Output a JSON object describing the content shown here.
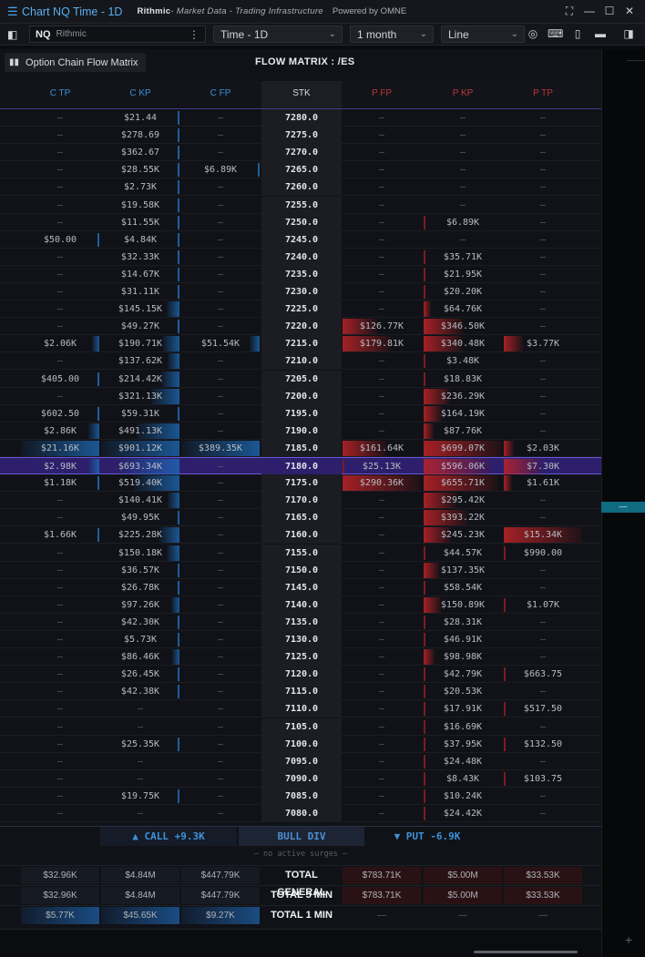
{
  "window": {
    "title": "Chart NQ Time - 1D",
    "brand": "Rithmic",
    "brand_tagline": "- Market Data - Trading Infrastructure",
    "powered_by": "Powered by OMNE"
  },
  "toolbar": {
    "symbol": "NQ",
    "source": "Rithmic",
    "timeframe": "Time - 1D",
    "period": "1 month",
    "chart_type": "Line"
  },
  "panel": {
    "tab_label": "Option Chain Flow Matrix",
    "title": "FLOW MATRIX : /ES"
  },
  "columns": [
    "C TP",
    "C KP",
    "C FP",
    "STK",
    "P FP",
    "P KP",
    "P TP"
  ],
  "rows": [
    {
      "ctp": "—",
      "ckp": "$21.44",
      "cfp": "—",
      "stk": "7280.0",
      "pfp": "—",
      "pkp": "—",
      "ptp": "—"
    },
    {
      "ctp": "—",
      "ckp": "$278.69",
      "cfp": "—",
      "stk": "7275.0",
      "pfp": "—",
      "pkp": "—",
      "ptp": "—"
    },
    {
      "ctp": "—",
      "ckp": "$362.67",
      "cfp": "—",
      "stk": "7270.0",
      "pfp": "—",
      "pkp": "—",
      "ptp": "—"
    },
    {
      "ctp": "—",
      "ckp": "$28.55K",
      "cfp": "$6.89K",
      "stk": "7265.0",
      "pfp": "—",
      "pkp": "—",
      "ptp": "—"
    },
    {
      "ctp": "—",
      "ckp": "$2.73K",
      "cfp": "—",
      "stk": "7260.0",
      "pfp": "—",
      "pkp": "—",
      "ptp": "—"
    },
    {
      "ctp": "—",
      "ckp": "$19.58K",
      "cfp": "—",
      "stk": "7255.0",
      "pfp": "—",
      "pkp": "—",
      "ptp": "—"
    },
    {
      "ctp": "—",
      "ckp": "$11.55K",
      "cfp": "—",
      "stk": "7250.0",
      "pfp": "—",
      "pkp": "$6.89K",
      "ptp": "—"
    },
    {
      "ctp": "$50.00",
      "ckp": "$4.84K",
      "cfp": "—",
      "stk": "7245.0",
      "pfp": "—",
      "pkp": "—",
      "ptp": "—"
    },
    {
      "ctp": "—",
      "ckp": "$32.33K",
      "cfp": "—",
      "stk": "7240.0",
      "pfp": "—",
      "pkp": "$35.71K",
      "ptp": "—"
    },
    {
      "ctp": "—",
      "ckp": "$14.67K",
      "cfp": "—",
      "stk": "7235.0",
      "pfp": "—",
      "pkp": "$21.95K",
      "ptp": "—"
    },
    {
      "ctp": "—",
      "ckp": "$31.11K",
      "cfp": "—",
      "stk": "7230.0",
      "pfp": "—",
      "pkp": "$20.20K",
      "ptp": "—"
    },
    {
      "ctp": "—",
      "ckp": "$145.15K",
      "cfp": "—",
      "stk": "7225.0",
      "pfp": "—",
      "pkp": "$64.76K",
      "ptp": "—"
    },
    {
      "ctp": "—",
      "ckp": "$49.27K",
      "cfp": "—",
      "stk": "7220.0",
      "pfp": "$126.77K",
      "pkp": "$346.50K",
      "ptp": "—"
    },
    {
      "ctp": "$2.06K",
      "ckp": "$190.71K",
      "cfp": "$51.54K",
      "stk": "7215.0",
      "pfp": "$179.81K",
      "pkp": "$340.48K",
      "ptp": "$3.77K"
    },
    {
      "ctp": "—",
      "ckp": "$137.62K",
      "cfp": "—",
      "stk": "7210.0",
      "pfp": "—",
      "pkp": "$3.48K",
      "ptp": "—"
    },
    {
      "ctp": "$405.00",
      "ckp": "$214.42K",
      "cfp": "—",
      "stk": "7205.0",
      "pfp": "—",
      "pkp": "$18.83K",
      "ptp": "—"
    },
    {
      "ctp": "—",
      "ckp": "$321.13K",
      "cfp": "—",
      "stk": "7200.0",
      "pfp": "—",
      "pkp": "$236.29K",
      "ptp": "—"
    },
    {
      "ctp": "$602.50",
      "ckp": "$59.31K",
      "cfp": "—",
      "stk": "7195.0",
      "pfp": "—",
      "pkp": "$164.19K",
      "ptp": "—"
    },
    {
      "ctp": "$2.86K",
      "ckp": "$491.13K",
      "cfp": "—",
      "stk": "7190.0",
      "pfp": "—",
      "pkp": "$87.76K",
      "ptp": "—"
    },
    {
      "ctp": "$21.16K",
      "ckp": "$901.12K",
      "cfp": "$389.35K",
      "stk": "7185.0",
      "pfp": "$161.64K",
      "pkp": "$699.07K",
      "ptp": "$2.03K"
    },
    {
      "ctp": "$2.98K",
      "ckp": "$693.34K",
      "cfp": "—",
      "stk": "7180.0",
      "pfp": "$25.13K",
      "pkp": "$596.06K",
      "ptp": "$7.30K",
      "highlight": true
    },
    {
      "ctp": "$1.18K",
      "ckp": "$519.40K",
      "cfp": "—",
      "stk": "7175.0",
      "pfp": "$290.36K",
      "pkp": "$655.71K",
      "ptp": "$1.61K"
    },
    {
      "ctp": "—",
      "ckp": "$140.41K",
      "cfp": "—",
      "stk": "7170.0",
      "pfp": "—",
      "pkp": "$295.42K",
      "ptp": "—"
    },
    {
      "ctp": "—",
      "ckp": "$49.95K",
      "cfp": "—",
      "stk": "7165.0",
      "pfp": "—",
      "pkp": "$393.22K",
      "ptp": "—"
    },
    {
      "ctp": "$1.66K",
      "ckp": "$225.28K",
      "cfp": "—",
      "stk": "7160.0",
      "pfp": "—",
      "pkp": "$245.23K",
      "ptp": "$15.34K"
    },
    {
      "ctp": "—",
      "ckp": "$150.18K",
      "cfp": "—",
      "stk": "7155.0",
      "pfp": "—",
      "pkp": "$44.57K",
      "ptp": "$990.00"
    },
    {
      "ctp": "—",
      "ckp": "$36.57K",
      "cfp": "—",
      "stk": "7150.0",
      "pfp": "—",
      "pkp": "$137.35K",
      "ptp": "—"
    },
    {
      "ctp": "—",
      "ckp": "$26.78K",
      "cfp": "—",
      "stk": "7145.0",
      "pfp": "—",
      "pkp": "$58.54K",
      "ptp": "—"
    },
    {
      "ctp": "—",
      "ckp": "$97.26K",
      "cfp": "—",
      "stk": "7140.0",
      "pfp": "—",
      "pkp": "$150.89K",
      "ptp": "$1.07K"
    },
    {
      "ctp": "—",
      "ckp": "$42.30K",
      "cfp": "—",
      "stk": "7135.0",
      "pfp": "—",
      "pkp": "$28.31K",
      "ptp": "—"
    },
    {
      "ctp": "—",
      "ckp": "$5.73K",
      "cfp": "—",
      "stk": "7130.0",
      "pfp": "—",
      "pkp": "$46.91K",
      "ptp": "—"
    },
    {
      "ctp": "—",
      "ckp": "$86.46K",
      "cfp": "—",
      "stk": "7125.0",
      "pfp": "—",
      "pkp": "$98.98K",
      "ptp": "—"
    },
    {
      "ctp": "—",
      "ckp": "$26.45K",
      "cfp": "—",
      "stk": "7120.0",
      "pfp": "—",
      "pkp": "$42.79K",
      "ptp": "$663.75"
    },
    {
      "ctp": "—",
      "ckp": "$42.38K",
      "cfp": "—",
      "stk": "7115.0",
      "pfp": "—",
      "pkp": "$20.53K",
      "ptp": "—"
    },
    {
      "ctp": "—",
      "ckp": "—",
      "cfp": "—",
      "stk": "7110.0",
      "pfp": "—",
      "pkp": "$17.91K",
      "ptp": "$517.50"
    },
    {
      "ctp": "—",
      "ckp": "—",
      "cfp": "—",
      "stk": "7105.0",
      "pfp": "—",
      "pkp": "$16.69K",
      "ptp": "—"
    },
    {
      "ctp": "—",
      "ckp": "$25.35K",
      "cfp": "—",
      "stk": "7100.0",
      "pfp": "—",
      "pkp": "$37.95K",
      "ptp": "$132.50"
    },
    {
      "ctp": "—",
      "ckp": "—",
      "cfp": "—",
      "stk": "7095.0",
      "pfp": "—",
      "pkp": "$24.48K",
      "ptp": "—"
    },
    {
      "ctp": "—",
      "ckp": "—",
      "cfp": "—",
      "stk": "7090.0",
      "pfp": "—",
      "pkp": "$8.43K",
      "ptp": "$103.75"
    },
    {
      "ctp": "—",
      "ckp": "$19.75K",
      "cfp": "—",
      "stk": "7085.0",
      "pfp": "—",
      "pkp": "$10.24K",
      "ptp": "—"
    },
    {
      "ctp": "—",
      "ckp": "—",
      "cfp": "—",
      "stk": "7080.0",
      "pfp": "—",
      "pkp": "$24.42K",
      "ptp": "—"
    }
  ],
  "flow": {
    "call": "▲ CALL +9.3K",
    "divergence": "BULL DIV",
    "put": "▼ PUT -6.9K",
    "surges": "— no active surges —"
  },
  "totals": [
    {
      "label": "TOTAL GENERAL",
      "ctp": "$32.96K",
      "ckp": "$4.84M",
      "cfp": "$447.79K",
      "pfp": "$783.71K",
      "pkp": "$5.00M",
      "ptp": "$33.53K"
    },
    {
      "label": "TOTAL 5 MIN",
      "ctp": "$32.96K",
      "ckp": "$4.84M",
      "cfp": "$447.79K",
      "pfp": "$783.71K",
      "pkp": "$5.00M",
      "ptp": "$33.53K"
    },
    {
      "label": "TOTAL 1 MIN",
      "ctp": "$5.77K",
      "ckp": "$45.65K",
      "cfp": "$9.27K",
      "pfp": "—",
      "pkp": "—",
      "ptp": "—"
    }
  ],
  "price_tag": "—",
  "colors": {
    "call": "#3a8fd4",
    "put": "#c0353a",
    "highlight": "#2d1f6b",
    "price_tag": "#0f6b7f"
  }
}
